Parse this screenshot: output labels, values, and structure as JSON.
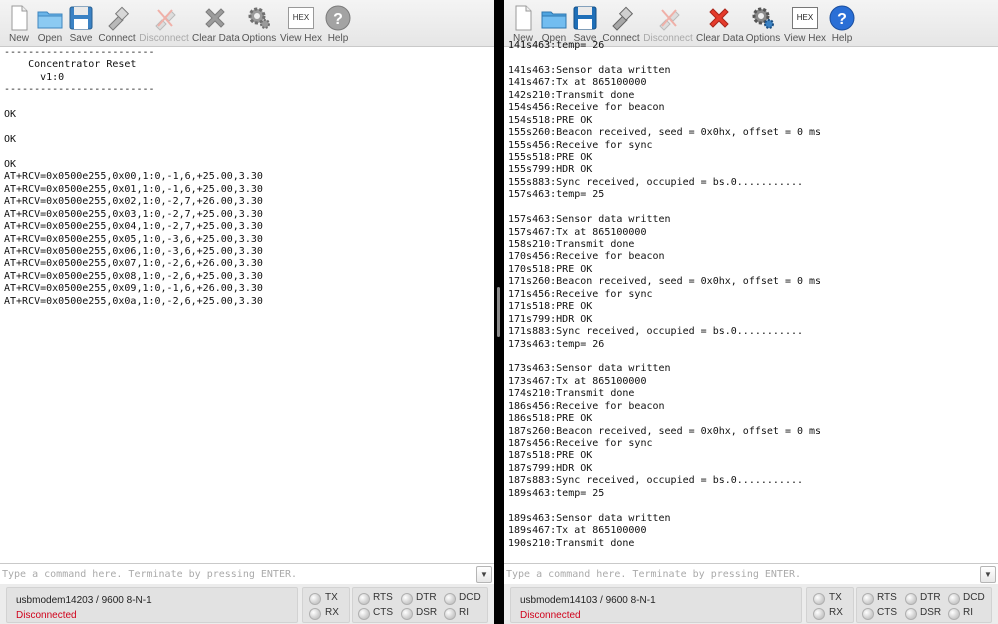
{
  "toolbar": [
    {
      "label": "New",
      "icon": "new-file-icon",
      "enabled": true
    },
    {
      "label": "Open",
      "icon": "folder-open-icon",
      "enabled": true
    },
    {
      "label": "Save",
      "icon": "floppy-save-icon",
      "enabled": true
    },
    {
      "label": "Connect",
      "icon": "plug-connect-icon",
      "enabled": true
    },
    {
      "label": "Disconnect",
      "icon": "plug-disconnect-icon",
      "enabled": false
    },
    {
      "label": "Clear Data",
      "icon": "red-x-icon",
      "enabled": true
    },
    {
      "label": "Options",
      "icon": "gear-options-icon",
      "enabled": true
    },
    {
      "label": "View Hex",
      "icon": "hex-icon",
      "enabled": true
    },
    {
      "label": "Help",
      "icon": "help-icon",
      "enabled": true
    }
  ],
  "hex_icon_text": "HEX",
  "left": {
    "lines": [
      "-------------------------",
      "    Concentrator Reset",
      "      v1:0",
      "-------------------------",
      "",
      "OK",
      "",
      "OK",
      "",
      "OK",
      "AT+RCV=0x0500e255,0x00,1:0,-1,6,+25.00,3.30",
      "AT+RCV=0x0500e255,0x01,1:0,-1,6,+25.00,3.30",
      "AT+RCV=0x0500e255,0x02,1:0,-2,7,+26.00,3.30",
      "AT+RCV=0x0500e255,0x03,1:0,-2,7,+25.00,3.30",
      "AT+RCV=0x0500e255,0x04,1:0,-2,7,+25.00,3.30",
      "AT+RCV=0x0500e255,0x05,1:0,-3,6,+25.00,3.30",
      "AT+RCV=0x0500e255,0x06,1:0,-3,6,+25.00,3.30",
      "AT+RCV=0x0500e255,0x07,1:0,-2,6,+26.00,3.30",
      "AT+RCV=0x0500e255,0x08,1:0,-2,6,+25.00,3.30",
      "AT+RCV=0x0500e255,0x09,1:0,-1,6,+26.00,3.30",
      "AT+RCV=0x0500e255,0x0a,1:0,-2,6,+25.00,3.30"
    ],
    "command_placeholder": "Type a command here. Terminate by pressing ENTER.",
    "port": "usbmodem14203 / 9600 8-N-1",
    "state": "Disconnected"
  },
  "right": {
    "lines": [
      "141s463:temp= 26",
      "",
      "141s463:Sensor data written",
      "141s467:Tx at 865100000",
      "142s210:Transmit done",
      "154s456:Receive for beacon",
      "154s518:PRE OK",
      "155s260:Beacon received, seed = 0x0hx, offset = 0 ms",
      "155s456:Receive for sync",
      "155s518:PRE OK",
      "155s799:HDR OK",
      "155s883:Sync received, occupied = bs.0...........",
      "157s463:temp= 25",
      "",
      "157s463:Sensor data written",
      "157s467:Tx at 865100000",
      "158s210:Transmit done",
      "170s456:Receive for beacon",
      "170s518:PRE OK",
      "171s260:Beacon received, seed = 0x0hx, offset = 0 ms",
      "171s456:Receive for sync",
      "171s518:PRE OK",
      "171s799:HDR OK",
      "171s883:Sync received, occupied = bs.0...........",
      "173s463:temp= 26",
      "",
      "173s463:Sensor data written",
      "173s467:Tx at 865100000",
      "174s210:Transmit done",
      "186s456:Receive for beacon",
      "186s518:PRE OK",
      "187s260:Beacon received, seed = 0x0hx, offset = 0 ms",
      "187s456:Receive for sync",
      "187s518:PRE OK",
      "187s799:HDR OK",
      "187s883:Sync received, occupied = bs.0...........",
      "189s463:temp= 25",
      "",
      "189s463:Sensor data written",
      "189s467:Tx at 865100000",
      "190s210:Transmit done"
    ],
    "command_placeholder": "Type a command here. Terminate by pressing ENTER.",
    "port": "usbmodem14103 / 9600 8-N-1",
    "state": "Disconnected"
  },
  "signals": {
    "group1": [
      "TX",
      "RX"
    ],
    "group2": [
      "RTS",
      "CTS",
      "DTR",
      "DSR",
      "DCD",
      "RI"
    ]
  },
  "colors": {
    "disconnected": "#d0021b",
    "clear_red": "#e53b2c",
    "help_blue": "#2a6fd6"
  }
}
